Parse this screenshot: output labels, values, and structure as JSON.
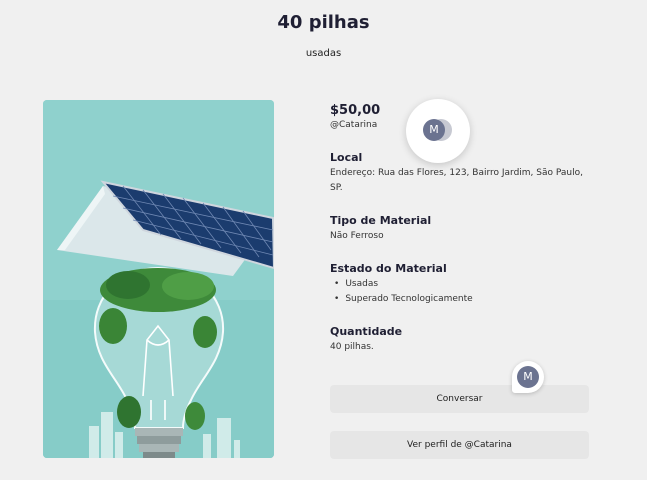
{
  "listing": {
    "title": "40 pilhas",
    "condition_tag": "usadas",
    "price": "$50,00",
    "seller": "@Catarina",
    "avatar_initial": "M",
    "image_icon": "solar-panel-lightbulb-photo"
  },
  "details": {
    "local_heading": "Local",
    "local_text": "Endereço: Rua das Flores, 123, Bairro Jardim, São Paulo, SP.",
    "material_type_heading": "Tipo de Material",
    "material_type_text": "Não Ferroso",
    "material_state_heading": "Estado do Material",
    "material_state_items": [
      "Usadas",
      "Superado Tecnologicamente"
    ],
    "quantity_heading": "Quantidade",
    "quantity_text": "40 pilhas."
  },
  "actions": {
    "chat_label": "Conversar",
    "profile_label": "Ver perfil de @Catarina",
    "chat_avatar_initial": "M"
  },
  "colors": {
    "background": "#f0f0f0",
    "button_bg": "#e6e6e6",
    "avatar_bg": "#6b7390",
    "photo_bg": "#8fd1cd"
  }
}
